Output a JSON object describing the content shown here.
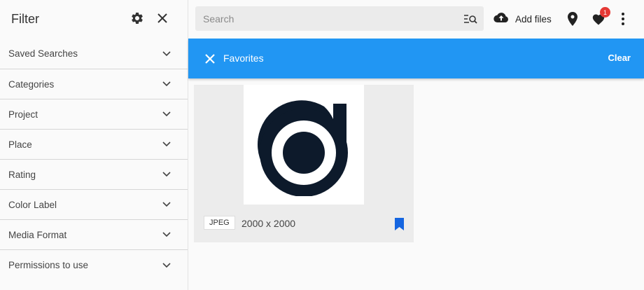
{
  "sidebar": {
    "title": "Filter",
    "settings_icon": "gear-icon",
    "close_icon": "close-icon",
    "items": [
      {
        "label": "Saved Searches"
      },
      {
        "label": "Categories"
      },
      {
        "label": "Project"
      },
      {
        "label": "Place"
      },
      {
        "label": "Rating"
      },
      {
        "label": "Color Label"
      },
      {
        "label": "Media Format"
      },
      {
        "label": "Permissions to use"
      }
    ]
  },
  "topbar": {
    "search_placeholder": "Search",
    "search_value": "",
    "add_files_label": "Add files",
    "favorites_badge_count": "1"
  },
  "filterbar": {
    "label": "Favorites",
    "clear_label": "Clear",
    "color": "#2196f3"
  },
  "results": [
    {
      "type": "JPEG",
      "dimensions": "2000 x 2000",
      "bookmarked": true,
      "bookmark_color": "#1565e0"
    }
  ]
}
